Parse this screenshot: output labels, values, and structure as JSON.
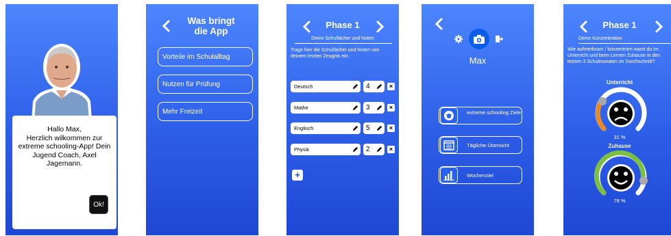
{
  "colors": {
    "bg_top": "#4d86ff",
    "bg_bottom": "#1f47d3",
    "accent_orange": "#e88a2a",
    "accent_green": "#7bc043",
    "camera_blue": "#0d5de8"
  },
  "screen1": {
    "greeting": "Hallo Max,",
    "message": "Herzlich wilkommen zur extreme schooling-App! Dein Jugend Coach, Axel Jagemann.",
    "ok_label": "Ok!"
  },
  "screen2": {
    "title_line1": "Was bringt",
    "title_line2": "die App",
    "buttons": [
      {
        "label": "Vorteile im Schulalltag"
      },
      {
        "label": "Nutzen für Prüfung"
      },
      {
        "label": "Mehr Freizeit"
      }
    ]
  },
  "screen3": {
    "title": "Phase 1",
    "subtitle": "Deine Schulfächer und Noten",
    "instruction": "Trage hier die Schulfächer und Noten von deinem letzten Zeugnis ein.",
    "subjects": [
      {
        "name": "Deutsch",
        "grade": "4"
      },
      {
        "name": "Mathe",
        "grade": "3"
      },
      {
        "name": "Englisch",
        "grade": "5"
      },
      {
        "name": "Physik",
        "grade": "2"
      }
    ],
    "add_label": "+",
    "remove_label": "×"
  },
  "screen4": {
    "username": "Max",
    "menu": [
      {
        "label": "extreme schooling Ziele",
        "icon": "graduation-cap-icon"
      },
      {
        "label": "Tägliche Übersicht",
        "icon": "calendar-icon"
      },
      {
        "label": "Wochenziel",
        "icon": "bar-chart-icon"
      }
    ]
  },
  "screen5": {
    "title": "Phase 1",
    "subtitle": "Deine Konzentration",
    "question": "Wie aufmerksam / konzentriert warst du im Unterricht und beim Lernen Zuhause in den letzten 3 Schulmonaten im Durchschnitt?",
    "gauges": [
      {
        "label": "Unterricht",
        "value": 31,
        "value_text": "31 %",
        "color": "#e88a2a",
        "mood": "sad"
      },
      {
        "label": "Zuhause",
        "value": 78,
        "value_text": "78 %",
        "color": "#7bc043",
        "mood": "happy"
      }
    ]
  }
}
